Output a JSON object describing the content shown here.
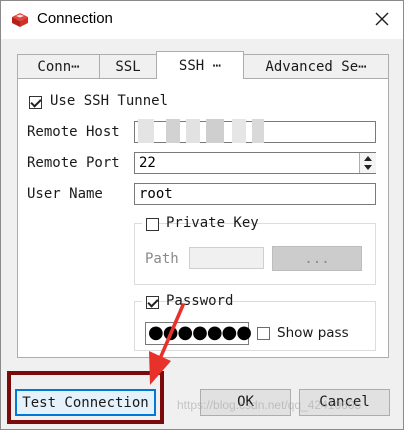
{
  "window": {
    "title": "Connection"
  },
  "tabs": [
    {
      "label": "Conn⋯",
      "active": false
    },
    {
      "label": "SSL",
      "active": false
    },
    {
      "label": "SSH ⋯",
      "active": true
    },
    {
      "label": "Advanced Se⋯",
      "active": false
    }
  ],
  "ssh": {
    "use_tunnel": {
      "label": "Use SSH Tunnel",
      "checked": true
    },
    "remote_host": {
      "label": "Remote Host",
      "value": ""
    },
    "remote_port": {
      "label": "Remote Port",
      "value": "22"
    },
    "user_name": {
      "label": "User Name",
      "value": "root"
    },
    "private_key": {
      "label": "Private Key",
      "checked": false,
      "path_label": "Path",
      "path_value": "",
      "browse_label": "..."
    },
    "password": {
      "label": "Password",
      "checked": true,
      "masked_value": "●●●●●●●",
      "show_pass_label": "Show pass",
      "show_pass_checked": false
    }
  },
  "buttons": {
    "test_connection": "Test Connection",
    "ok": "OK",
    "cancel": "Cancel"
  },
  "colors": {
    "highlight_border": "#7b0a0a",
    "annotation_arrow": "#e8312a",
    "window_bg": "#f0f0f0",
    "focus_blue": "#0078d7"
  },
  "watermark": "https://blog.csdn.net/qq_42410605"
}
